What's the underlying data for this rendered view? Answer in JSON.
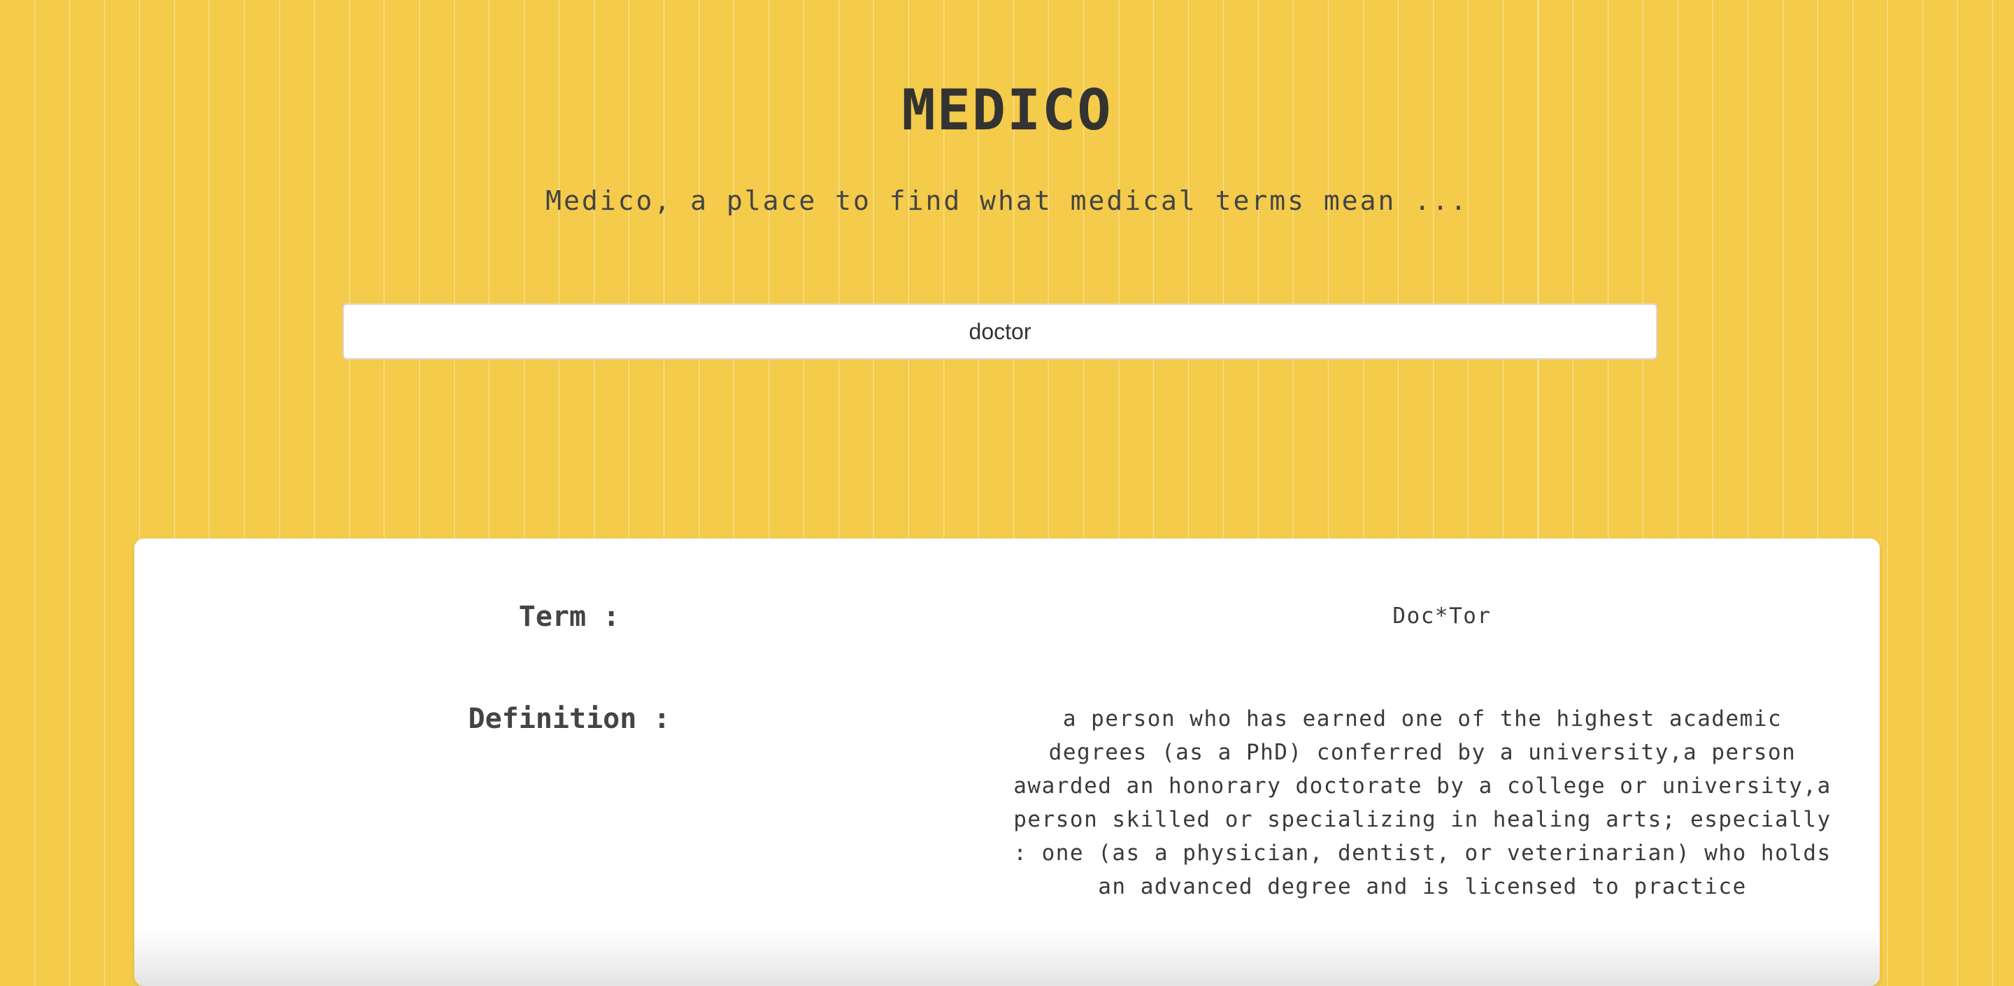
{
  "header": {
    "title": "MEDICO",
    "subtitle": "Medico, a place to find what medical terms mean ..."
  },
  "search": {
    "value": "doctor"
  },
  "result": {
    "term_label": "Term :",
    "term_value": "Doc*Tor",
    "definition_label": "Definition :",
    "definition_value": "a person who has earned one of the highest academic degrees (as a PhD) conferred by a university,a person awarded an honorary doctorate by a college or university,a person skilled or specializing in healing arts; especially : one (as a physician, dentist, or veterinarian) who holds an advanced degree and is licensed to practice"
  },
  "colors": {
    "background": "#f4cb4a",
    "card": "#ffffff",
    "text": "#333333"
  }
}
